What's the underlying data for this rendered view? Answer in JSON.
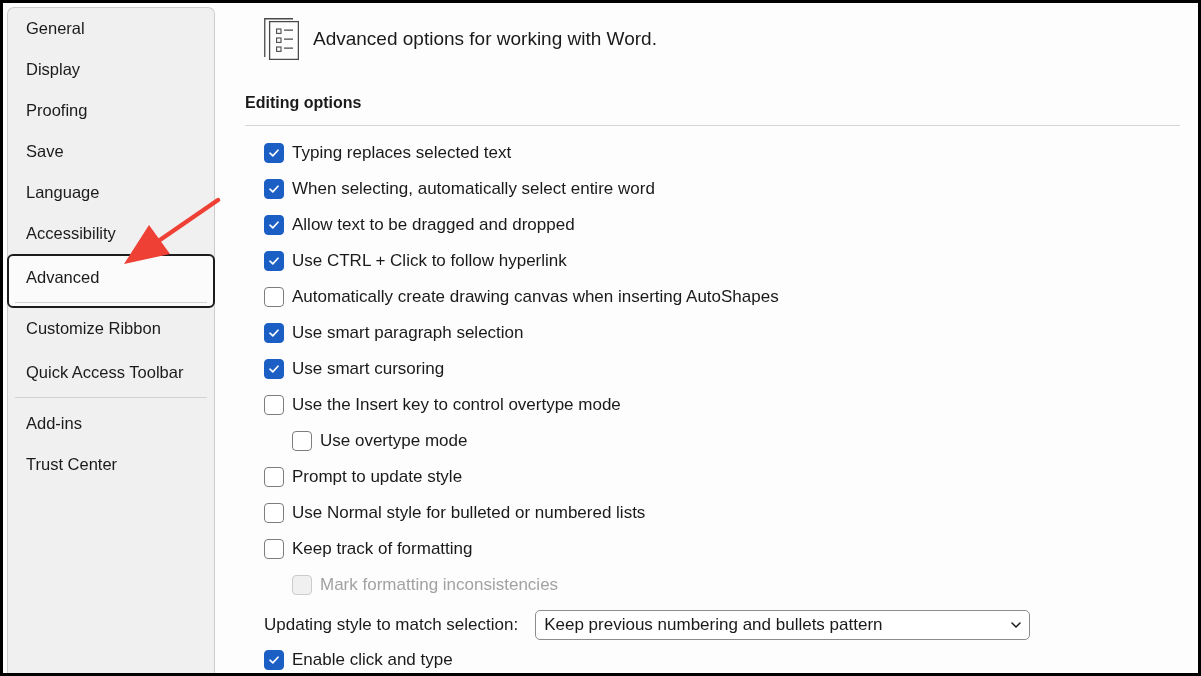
{
  "sidebar": {
    "groups": [
      {
        "items": [
          {
            "label": "General",
            "selected": false
          },
          {
            "label": "Display",
            "selected": false
          },
          {
            "label": "Proofing",
            "selected": false
          },
          {
            "label": "Save",
            "selected": false
          },
          {
            "label": "Language",
            "selected": false
          },
          {
            "label": "Accessibility",
            "selected": false
          },
          {
            "label": "Advanced",
            "selected": true
          }
        ]
      },
      {
        "items": [
          {
            "label": "Customize Ribbon",
            "selected": false
          },
          {
            "label": "Quick Access Toolbar",
            "selected": false
          }
        ]
      },
      {
        "items": [
          {
            "label": "Add-ins",
            "selected": false
          },
          {
            "label": "Trust Center",
            "selected": false
          }
        ]
      }
    ]
  },
  "header": {
    "title": "Advanced options for working with Word."
  },
  "section": {
    "title": "Editing options",
    "options": [
      {
        "kind": "checkbox",
        "label": "Typing replaces selected text",
        "checked": true,
        "disabled": false
      },
      {
        "kind": "checkbox",
        "label": "When selecting, automatically select entire word",
        "checked": true,
        "disabled": false
      },
      {
        "kind": "checkbox",
        "label": "Allow text to be dragged and dropped",
        "checked": true,
        "disabled": false
      },
      {
        "kind": "checkbox",
        "label": "Use CTRL + Click to follow hyperlink",
        "checked": true,
        "disabled": false
      },
      {
        "kind": "checkbox",
        "label": "Automatically create drawing canvas when inserting AutoShapes",
        "checked": false,
        "disabled": false
      },
      {
        "kind": "checkbox",
        "label": "Use smart paragraph selection",
        "checked": true,
        "disabled": false
      },
      {
        "kind": "checkbox",
        "label": "Use smart cursoring",
        "checked": true,
        "disabled": false
      },
      {
        "kind": "checkbox",
        "label": "Use the Insert key to control overtype mode",
        "checked": false,
        "disabled": false,
        "children": [
          {
            "kind": "checkbox",
            "label": "Use overtype mode",
            "checked": false,
            "disabled": false
          }
        ]
      },
      {
        "kind": "checkbox",
        "label": "Prompt to update style",
        "checked": false,
        "disabled": false
      },
      {
        "kind": "checkbox",
        "label": "Use Normal style for bulleted or numbered lists",
        "checked": false,
        "disabled": false
      },
      {
        "kind": "checkbox",
        "label": "Keep track of formatting",
        "checked": false,
        "disabled": false,
        "children": [
          {
            "kind": "checkbox",
            "label": "Mark formatting inconsistencies",
            "checked": false,
            "disabled": true
          }
        ]
      },
      {
        "kind": "dropdown",
        "label": "Updating style to match selection:",
        "value": "Keep previous numbering and bullets pattern"
      },
      {
        "kind": "checkbox",
        "label": "Enable click and type",
        "checked": true,
        "disabled": false
      }
    ]
  }
}
